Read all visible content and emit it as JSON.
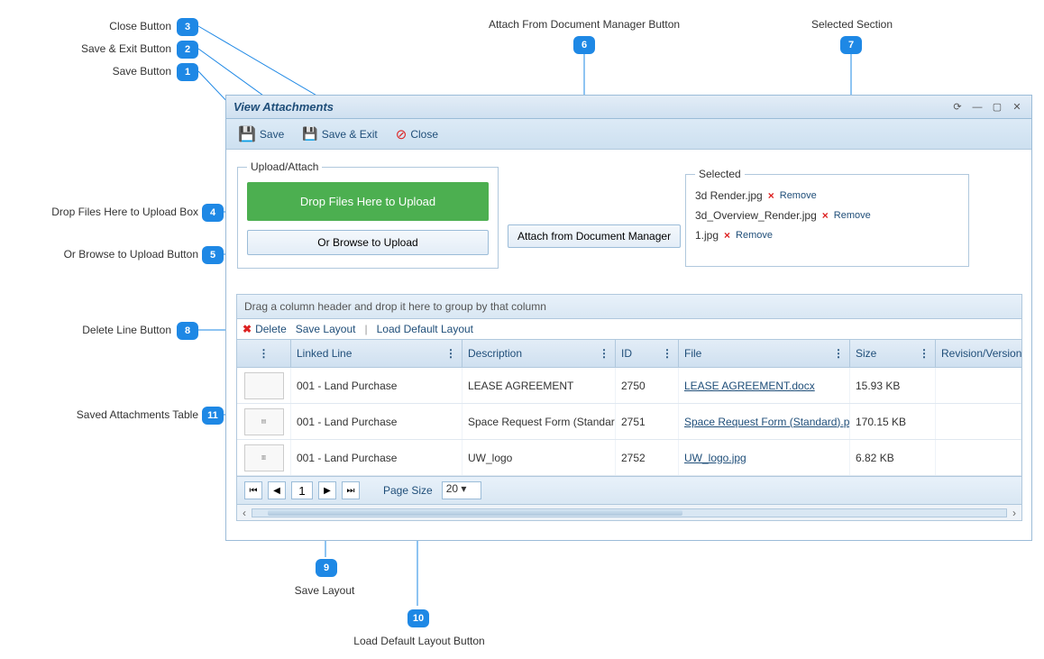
{
  "callouts": {
    "c1": "Save Button",
    "c2": "Save & Exit Button",
    "c3": "Close Button",
    "c4": "Drop Files Here to Upload Box",
    "c5": "Or Browse to Upload Button",
    "c6": "Attach From Document Manager Button",
    "c7": "Selected Section",
    "c8": "Delete Line Button",
    "c9": "Save Layout",
    "c10": "Load Default Layout Button",
    "c11": "Saved Attachments Table"
  },
  "window": {
    "title": "View Attachments"
  },
  "toolbar": {
    "save": "Save",
    "save_exit": "Save & Exit",
    "close": "Close"
  },
  "upload": {
    "legend": "Upload/Attach",
    "drop": "Drop Files Here to Upload",
    "browse": "Or Browse to Upload"
  },
  "attach_dm": "Attach from Document Manager",
  "selected": {
    "legend": "Selected",
    "items": [
      {
        "name": "3d Render.jpg"
      },
      {
        "name": "3d_Overview_Render.jpg"
      },
      {
        "name": "1.jpg"
      }
    ],
    "remove": "Remove"
  },
  "grid": {
    "group_hint": "Drag a column header and drop it here to group by that column",
    "toolbar": {
      "delete": "Delete",
      "save_layout": "Save Layout",
      "load_default": "Load Default Layout"
    },
    "cols": {
      "linked": "Linked Line",
      "desc": "Description",
      "id": "ID",
      "file": "File",
      "size": "Size",
      "rev": "Revision/Version"
    },
    "rows": [
      {
        "linked": "001 - Land Purchase",
        "desc": "LEASE AGREEMENT",
        "id": "2750",
        "file": "LEASE AGREEMENT.docx",
        "size": "15.93 KB"
      },
      {
        "linked": "001 - Land Purchase",
        "desc": "Space Request Form (Standard)",
        "id": "2751",
        "file": "Space Request Form (Standard).pdf",
        "size": "170.15 KB"
      },
      {
        "linked": "001 - Land Purchase",
        "desc": "UW_logo",
        "id": "2752",
        "file": "UW_logo.jpg",
        "size": "6.82 KB"
      }
    ],
    "pager": {
      "page": "1",
      "size_label": "Page Size",
      "size": "20"
    }
  }
}
